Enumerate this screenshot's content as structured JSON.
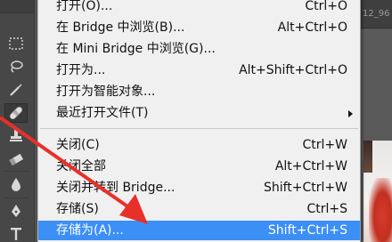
{
  "document_tab": {
    "title": "12_96"
  },
  "menu": {
    "items": [
      {
        "label": "打开(O)...",
        "shortcut": "Ctrl+O"
      },
      {
        "label": "在 Bridge 中浏览(B)...",
        "shortcut": "Alt+Ctrl+O"
      },
      {
        "label": "在 Mini Bridge 中浏览(G)...",
        "shortcut": ""
      },
      {
        "label": "打开为...",
        "shortcut": "Alt+Shift+Ctrl+O"
      },
      {
        "label": "打开为智能对象...",
        "shortcut": ""
      },
      {
        "label": "最近打开文件(T)",
        "shortcut": ""
      },
      {
        "label": "关闭(C)",
        "shortcut": "Ctrl+W"
      },
      {
        "label": "关闭全部",
        "shortcut": "Alt+Ctrl+W"
      },
      {
        "label": "关闭并转到 Bridge...",
        "shortcut": "Shift+Ctrl+W"
      },
      {
        "label": "存储(S)",
        "shortcut": "Ctrl+S"
      },
      {
        "label": "存储为(A)...",
        "shortcut": "Shift+Ctrl+S"
      }
    ],
    "highlighted_item": "存储为(A)...",
    "highlight_color": "#3c8ff5"
  },
  "toolbar": {
    "tools": [
      "marquee-tool",
      "lasso-tool",
      "quick-selection-tool",
      "healing-brush-tool",
      "clone-stamp-tool",
      "eraser-tool",
      "blur-tool",
      "pen-tool",
      "text-tool"
    ],
    "active_tool": "healing-brush-tool"
  },
  "annotation": {
    "arrow_color": "#e8302a"
  }
}
